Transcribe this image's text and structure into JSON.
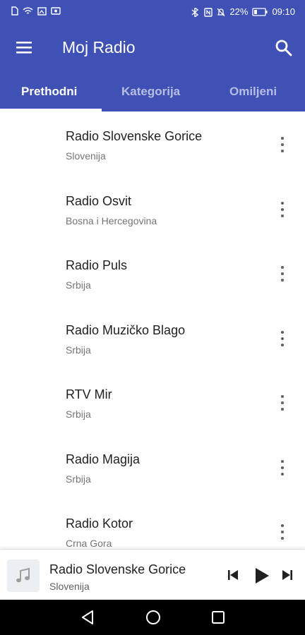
{
  "status_bar": {
    "battery": "22%",
    "time": "09:10",
    "icons": [
      "sim-card-icon",
      "wifi-icon",
      "screen-cast-icon",
      "photo-icon",
      "bluetooth-icon",
      "nfc-icon",
      "mute-icon",
      "battery-icon"
    ]
  },
  "app_bar": {
    "title": "Moj Radio",
    "menu_icon": "hamburger-menu-icon",
    "search_icon": "search-icon"
  },
  "tabs": [
    {
      "label": "Prethodni",
      "active": true
    },
    {
      "label": "Kategorija",
      "active": false
    },
    {
      "label": "Omiljeni",
      "active": false
    }
  ],
  "stations": [
    {
      "name": "Radio Slovenske Gorice",
      "country": "Slovenija"
    },
    {
      "name": "Radio Osvit",
      "country": "Bosna i Hercegovina"
    },
    {
      "name": "Radio Puls",
      "country": "Srbija"
    },
    {
      "name": "Radio Muzičko Blago",
      "country": "Srbija"
    },
    {
      "name": "RTV Mir",
      "country": "Srbija"
    },
    {
      "name": "Radio Magija",
      "country": "Srbija"
    },
    {
      "name": "Radio Kotor",
      "country": "Crna Gora"
    }
  ],
  "player": {
    "station": "Radio Slovenske Gorice",
    "country": "Slovenija",
    "icons": [
      "music-note-icon",
      "skip-previous-icon",
      "play-icon",
      "skip-next-icon"
    ]
  },
  "navigation_bar": {
    "icons": [
      "back-icon",
      "home-icon",
      "recents-icon"
    ]
  },
  "colors": {
    "primary": "#3f51b5",
    "text_primary": "#212121",
    "text_secondary": "#757575"
  }
}
